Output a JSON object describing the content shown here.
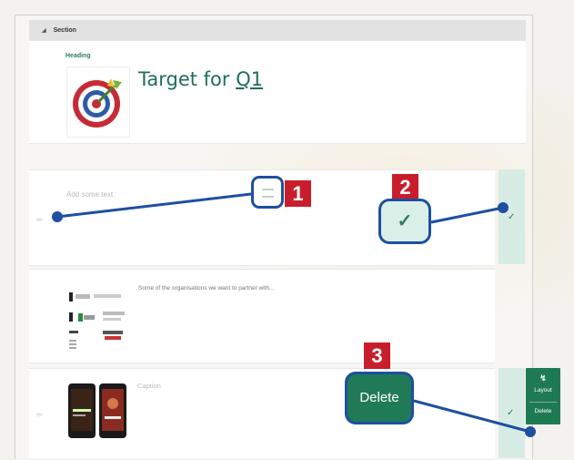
{
  "section": {
    "title": "Section",
    "collapse_icon": "caret-down-icon"
  },
  "card_heading": {
    "label": "Heading",
    "title_prefix": "Target for ",
    "title_link": "Q1",
    "image_icon": "target-dartboard-image"
  },
  "card_text": {
    "placeholder": "Add some text",
    "drag_handle_icon": "drag-handle-icon",
    "confirm_icon": "check-icon"
  },
  "card_partners": {
    "text": "Some of the organisations we want to partner with...",
    "image_icon": "partner-logos-image"
  },
  "card_media": {
    "caption": "Caption",
    "image_icon": "phones-image",
    "confirm_icon": "check-icon"
  },
  "popup_menu": {
    "layout_label": "Layout",
    "delete_label": "Delete",
    "layout_icon": "lightning-icon"
  },
  "callouts": {
    "one": "1",
    "two": "2",
    "three": "3",
    "delete_label": "Delete",
    "check_icon": "check-icon",
    "handle_icon": "drag-handle-icon"
  },
  "colors": {
    "accent_green": "#217a56",
    "callout_red": "#c81e2c",
    "callout_blue": "#1e4fa0",
    "panel_mint": "#d7ece4"
  }
}
